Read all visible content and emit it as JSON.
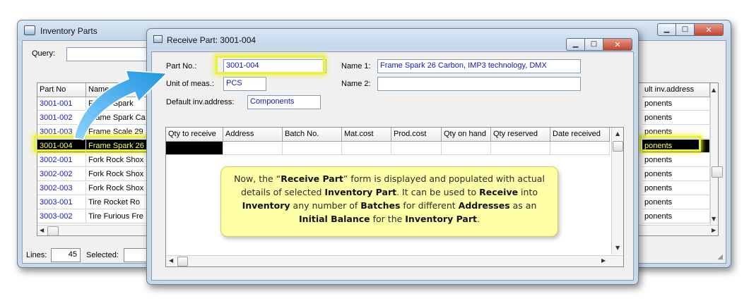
{
  "back_window": {
    "title": "Inventory Parts",
    "query_label": "Query:",
    "columns": [
      "Part No",
      "Name",
      "ult inv.address"
    ],
    "rows": [
      {
        "part_no": "3001-001",
        "name": "Frame Spark",
        "address": "ponents"
      },
      {
        "part_no": "3001-002",
        "name": "Frame Spark Ca",
        "address": "ponents"
      },
      {
        "part_no": "3001-003",
        "name": "Frame Scale 29",
        "address": "ponents"
      },
      {
        "part_no": "3001-004",
        "name": "Frame Spark 26",
        "address": "ponents"
      },
      {
        "part_no": "3002-001",
        "name": "Fork Rock Shox",
        "address": "ponents"
      },
      {
        "part_no": "3002-002",
        "name": "Fork Rock Shox",
        "address": "ponents"
      },
      {
        "part_no": "3002-003",
        "name": "Fork Rock Shox",
        "address": "ponents"
      },
      {
        "part_no": "3003-001",
        "name": "Tire Rocket Ro",
        "address": "ponents"
      },
      {
        "part_no": "3003-002",
        "name": "Tire Furious Fre",
        "address": "ponents"
      }
    ],
    "selected_row": 3,
    "status": {
      "lines_label": "Lines:",
      "lines_value": "45",
      "selected_label": "Selected:"
    }
  },
  "dialog": {
    "title": "Receive Part: 3001-004",
    "part_no_label": "Part No.:",
    "part_no": "3001-004",
    "uom_label": "Unit of meas.:",
    "uom": "PCS",
    "default_addr_label": "Default inv.address:",
    "default_addr": "Components",
    "name1_label": "Name 1:",
    "name1": "Frame Spark 26 Carbon, IMP3 technology, DMX",
    "name2_label": "Name 2:",
    "name2": "",
    "columns": [
      "Qty to receive",
      "Address",
      "Batch No.",
      "Mat.cost",
      "Prod.cost",
      "Qty on hand",
      "Qty reserved",
      "Date received"
    ]
  },
  "callout": {
    "t1": "Now, the “",
    "b1": "Receive Part",
    "t2": "” form is displayed and populated with actual details of selected ",
    "b2": "Inventory Part",
    "t3": ". It can be used to ",
    "b3": "Receive",
    "t4": " into ",
    "b4": "Inventory",
    "t5": " any number of ",
    "b5": "Batches",
    "t6": " for different ",
    "b6": "Addresses",
    "t7": " as an ",
    "b7": "Initial Balance",
    "t8": " for the ",
    "b8": "Inventory Part",
    "t9": "."
  },
  "colors": {
    "highlight": "#e7f23c",
    "callout_bg": "#ffffa8",
    "arrow": "#3aa8e8",
    "link_text": "#1515c8"
  }
}
